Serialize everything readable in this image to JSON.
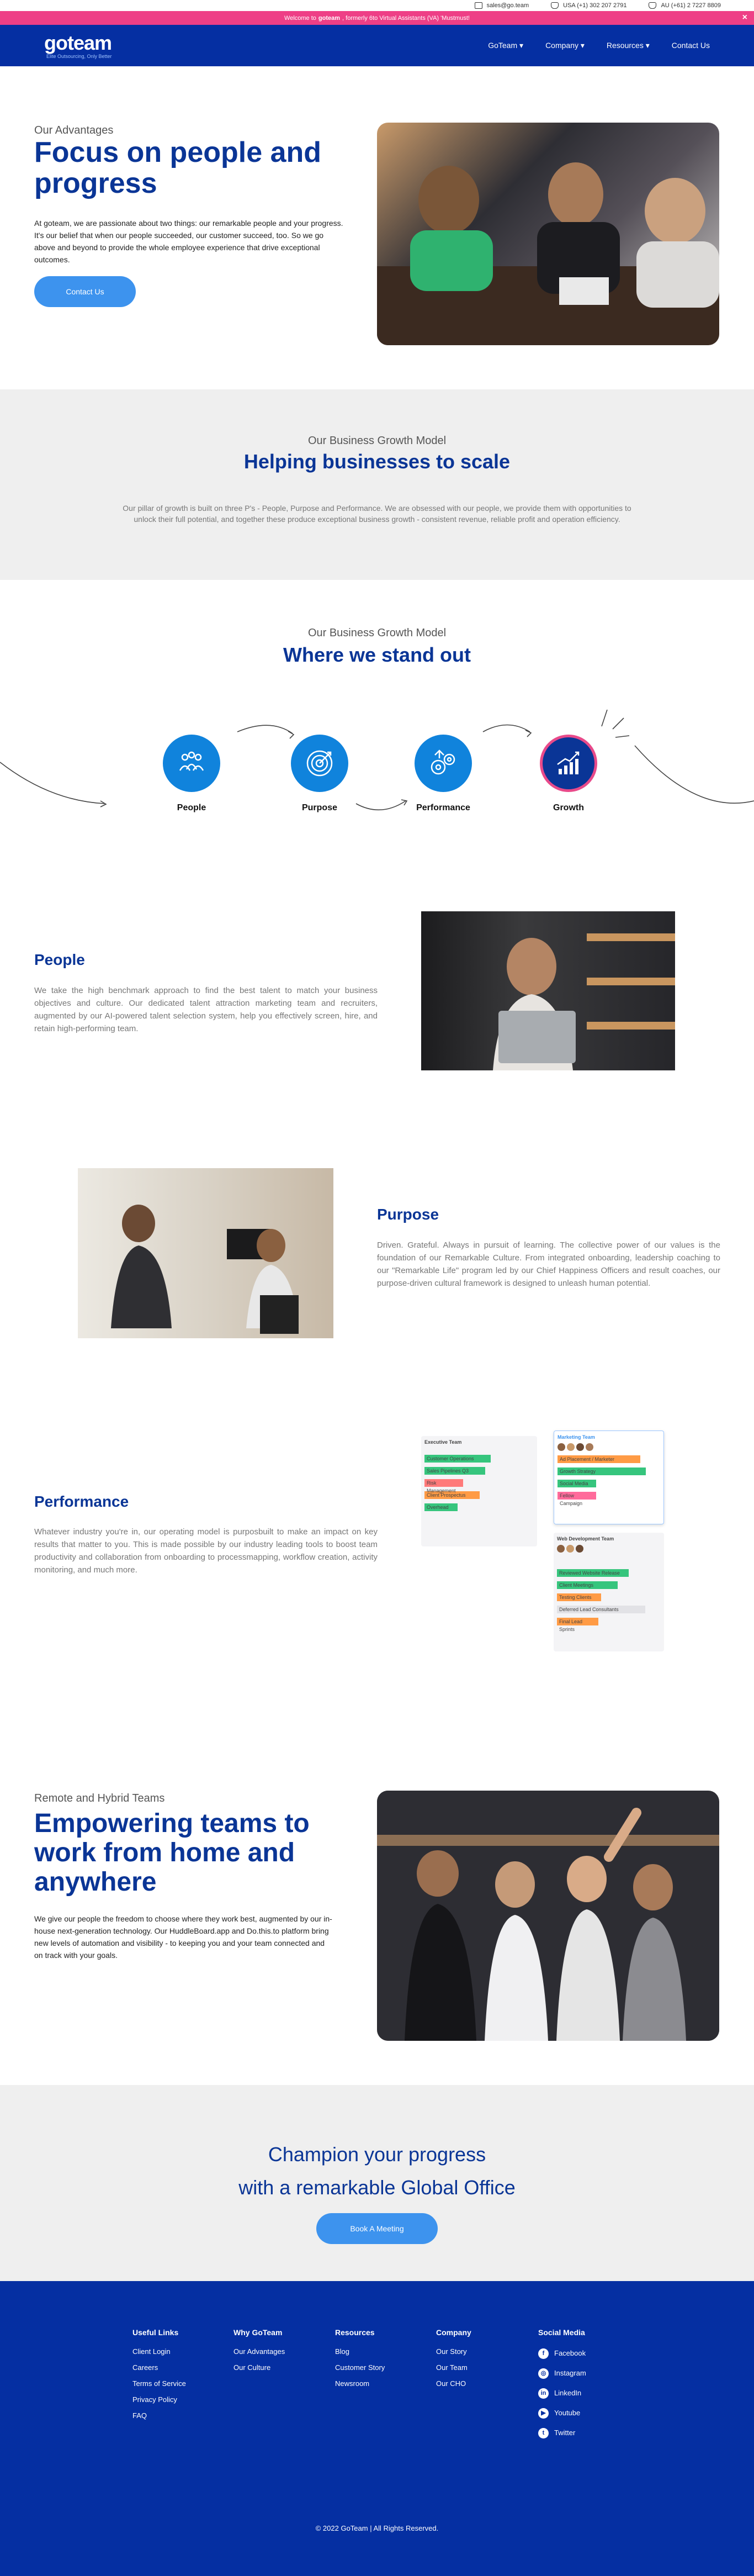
{
  "topbar": {
    "email": "sales@go.team",
    "usa": "USA (+1) 302 207 2791",
    "au": "AU (+61) 2 7227 8809"
  },
  "promo": {
    "prefix": "Welcome to",
    "brand": "goteam",
    "suffix": ", formerly 6to Virtual Assistants (VA) 'Mustmust!",
    "close": "×"
  },
  "nav": {
    "logo": "goteam",
    "logo_tag": "Elite Outsourcing, Only Better",
    "items": [
      "GoTeam",
      "Company",
      "Resources",
      "Contact Us"
    ]
  },
  "advantages": {
    "eyebrow": "Our Advantages",
    "title": "Focus on people and progress",
    "body": "At goteam, we are passionate about two things: our remarkable people and your progress. It's our belief that when our people succeeded, our customer succeed, too. So we go above and beyond to provide the whole employee experience that drive exceptional outcomes.",
    "button": "Contact Us"
  },
  "growth": {
    "eyebrow": "Our Business Growth Model",
    "title": "Helping businesses to scale",
    "desc": "Our pillar of growth is built on three P's - People, Purpose and Performance. We are obsessed with our people, we provide them with opportunities to unlock their full potential, and together these produce exceptional business growth - consistent revenue, reliable profit and operation efficiency."
  },
  "standout": {
    "eyebrow": "Our Business Growth Model",
    "title": "Where we stand out",
    "pillars": [
      "People",
      "Purpose",
      "Performance",
      "Growth"
    ]
  },
  "people": {
    "title": "People",
    "body": "We take the high benchmark approach to find the best talent to match your business objectives and culture. Our dedicated talent attraction marketing team and recruiters, augmented by our AI-powered talent selection system, help you effectively screen, hire, and retain high-performing team."
  },
  "purpose": {
    "title": "Purpose",
    "body": "Driven. Grateful. Always in pursuit of learning. The collective power of our values is the foundation of our Remarkable Culture. From integrated onboarding, leadership coaching to our \"Remarkable Life\" program led by our Chief Happiness Officers and result coaches, our purpose-driven cultural framework is designed to unleash human potential."
  },
  "performance": {
    "title": "Performance",
    "body": "Whatever industry you're in, our operating model is purposbuilt to make an impact on key results that matter to you. This is made possible by our industry leading tools to boost team productivity and collaboration from onboarding to processmapping, workflow creation, activity monitoring, and much more.",
    "board": {
      "exec_title": "Executive Team",
      "marketing_title": "Marketing Team",
      "web_title": "Web Development Team",
      "exec_rows": [
        "Customer Operations",
        "Sales Pipelines Q3",
        "Risk Management",
        "Client Prospectus",
        "Overhead"
      ],
      "marketing_rows": [
        "Ad Placement / Marketer",
        "Growth Strategy",
        "Social Media",
        "Fellow Campaign"
      ],
      "web_rows": [
        "Reviewed Website Release",
        "Client Meetings",
        "Testing Clients",
        "Deferred Lead Consultants",
        "Final Lead Sprints"
      ]
    }
  },
  "remote": {
    "eyebrow": "Remote and Hybrid Teams",
    "title": "Empowering teams to work from home and anywhere",
    "body": "We give our people the freedom to choose where they work best, augmented by our in-house next-generation technology. Our HuddleBoard.app and Do.this.to platform bring new levels of automation and visibility - to keeping you and your team connected and on track with your goals."
  },
  "champion": {
    "line1": "Champion your progress",
    "line2": "with a remarkable Global Office",
    "button": "Book A Meeting"
  },
  "footer": {
    "cols": [
      {
        "heading": "Useful Links",
        "links": [
          "Client Login",
          "Careers",
          "Terms of Service",
          "Privacy Policy",
          "FAQ"
        ]
      },
      {
        "heading": "Why GoTeam",
        "links": [
          "Our Advantages",
          "Our Culture"
        ]
      },
      {
        "heading": "Resources",
        "links": [
          "Blog",
          "Customer Story",
          "Newsroom"
        ]
      },
      {
        "heading": "Company",
        "links": [
          "Our Story",
          "Our Team",
          "Our CHO"
        ]
      }
    ],
    "social_heading": "Social Media",
    "social": [
      "Facebook",
      "Instagram",
      "LinkedIn",
      "Youtube",
      "Twitter"
    ],
    "copyright": "© 2022 GoTeam | All Rights Reserved."
  },
  "colors": {
    "brand_blue": "#052fa2",
    "heading_blue": "#0a3596",
    "accent_blue": "#3d93ee",
    "pink": "#ee3f86"
  }
}
